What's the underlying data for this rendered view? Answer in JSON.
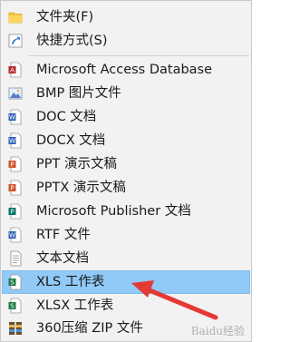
{
  "menu": {
    "items": [
      {
        "label": "文件夹(F)",
        "icon": "folder-icon"
      },
      {
        "label": "快捷方式(S)",
        "icon": "shortcut-icon"
      },
      {
        "label": "Microsoft Access Database",
        "icon": "access-file-icon"
      },
      {
        "label": "BMP 图片文件",
        "icon": "bmp-file-icon"
      },
      {
        "label": "DOC 文档",
        "icon": "word-file-icon"
      },
      {
        "label": "DOCX 文档",
        "icon": "word-file-icon"
      },
      {
        "label": "PPT 演示文稿",
        "icon": "ppt-file-icon"
      },
      {
        "label": "PPTX 演示文稿",
        "icon": "ppt-file-icon"
      },
      {
        "label": "Microsoft Publisher 文档",
        "icon": "publisher-file-icon"
      },
      {
        "label": "RTF 文件",
        "icon": "rtf-file-icon"
      },
      {
        "label": "文本文档",
        "icon": "text-file-icon"
      },
      {
        "label": "XLS 工作表",
        "icon": "excel-file-icon"
      },
      {
        "label": "XLSX 工作表",
        "icon": "excel-file-icon"
      },
      {
        "label": "360压缩 ZIP 文件",
        "icon": "zip-file-icon"
      }
    ],
    "selected_label": "XLS 工作表"
  },
  "watermark": "Baidu经验",
  "colors": {
    "menu_bg": "#f2f2f2",
    "highlight": "#91c9f7",
    "arrow": "#e53935"
  }
}
